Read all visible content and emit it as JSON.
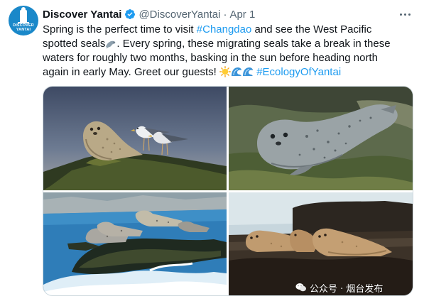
{
  "account": {
    "avatar_text_line1": "DISCOVER",
    "avatar_text_line2": "YANTAI",
    "display_name": "Discover Yantai",
    "handle": "@DiscoverYantai",
    "separator": "·",
    "date": "Apr 1"
  },
  "tweet": {
    "segments": [
      {
        "type": "text",
        "value": "Spring is the perfect time to visit "
      },
      {
        "type": "hashtag",
        "value": "#Changdao"
      },
      {
        "type": "text",
        "value": " and see the West Pacific spotted seals"
      },
      {
        "type": "emoji",
        "value": "seal"
      },
      {
        "type": "text",
        "value": ". Every spring, these migrating seals take a break in these waters for roughly two months, basking in the sun before heading north again in early May. Greet our guests! "
      },
      {
        "type": "emoji",
        "value": "sun"
      },
      {
        "type": "emoji",
        "value": "wave"
      },
      {
        "type": "emoji",
        "value": "wave"
      },
      {
        "type": "text",
        "value": " "
      },
      {
        "type": "hashtag",
        "value": "#EcologyOfYantai"
      }
    ]
  },
  "media": {
    "photos": [
      {
        "name": "photo-seal-with-gulls",
        "subject": "seal and two gulls on rock at sunset"
      },
      {
        "name": "photo-seal-closeup",
        "subject": "spotted seal resting on mossy rock"
      },
      {
        "name": "photo-seals-coast",
        "subject": "seals on rocks with waves"
      },
      {
        "name": "photo-seals-group",
        "subject": "group of seals on rocks"
      }
    ],
    "watermark": "公众号 · 烟台发布"
  },
  "colors": {
    "hashtag": "#1d9bf0",
    "secondary_text": "#536471",
    "verified": "#1d9bf0",
    "avatar_bg": "#1a88c9"
  },
  "icons": {
    "verified": "verified-badge-icon",
    "more": "more-options-icon",
    "watermark": "wechat-icon"
  }
}
